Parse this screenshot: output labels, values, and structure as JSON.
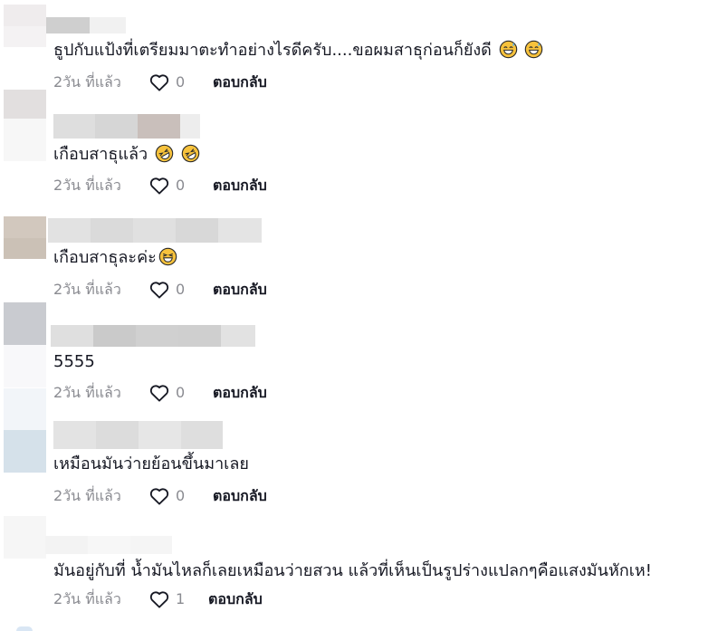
{
  "comments": [
    {
      "text": "ธูปกับแป้งที่เตรียมมาตะทำอย่างไรดีครับ....ขอผมสาธุก่อนก็ยังดี",
      "emoji": [
        "sweat-smile",
        "sweat-smile"
      ],
      "time": "2วัน ที่แล้ว",
      "likes": "0",
      "reply": "ตอบกลับ"
    },
    {
      "text": "เกือบสาธุแล้ว",
      "emoji": [
        "rolling-laugh",
        "rolling-laugh"
      ],
      "time": "2วัน ที่แล้ว",
      "likes": "0",
      "reply": "ตอบกลับ"
    },
    {
      "text": "เกือบสาธุละค่ะ",
      "emoji": [
        "grin-squint"
      ],
      "time": "2วัน ที่แล้ว",
      "likes": "0",
      "reply": "ตอบกลับ"
    },
    {
      "text": "5555",
      "emoji": [],
      "time": "2วัน ที่แล้ว",
      "likes": "0",
      "reply": "ตอบกลับ"
    },
    {
      "text": "เหมือนมันว่ายย้อนขึ้นมาเลย",
      "emoji": [],
      "time": "2วัน ที่แล้ว",
      "likes": "0",
      "reply": "ตอบกลับ"
    },
    {
      "text": "มันอยู่กับที่ น้ำมันไหลก็เลยเหมือนว่ายสวน แล้วที่เห็นเป็นรูปร่างแปลกๆคือแสงมันหักเห!",
      "emoji": [],
      "time": "2วัน ที่แล้ว",
      "likes": "1",
      "reply": "ตอบกลับ"
    }
  ],
  "icons": {
    "like": "heart-outline-icon",
    "emoji_sweat_smile": "sweat-smile-emoji-icon",
    "emoji_rolling_laugh": "rolling-on-floor-laughing-emoji-icon",
    "emoji_grin_squint": "grinning-squinting-emoji-icon"
  },
  "colors": {
    "text": "#161823",
    "meta": "#8a8b91",
    "emoji_face": "#f7c23c",
    "emoji_outline": "#2b2b2b"
  }
}
